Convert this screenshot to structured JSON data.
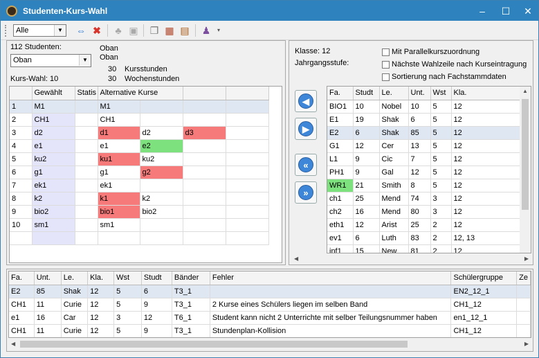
{
  "window": {
    "title": "Studenten-Kurs-Wahl",
    "minimize": "–",
    "maximize": "☐",
    "close": "✕"
  },
  "toolbar": {
    "filter_value": "Alle"
  },
  "left": {
    "student_count": "112 Studenten:",
    "student_value": "Oban",
    "name1": "Oban",
    "name2": "Oban",
    "kursstunden_num": "30",
    "kursstunden_label": "Kursstunden",
    "wochenstunden_num": "30",
    "wochenstunden_label": "Wochenstunden",
    "kurswahl": "Kurs-Wahl: 10",
    "headers": [
      "",
      "Gewählt",
      "Statis",
      "Alternative Kurse",
      "",
      ""
    ],
    "rows": [
      {
        "n": "1",
        "g": "M1",
        "s": "",
        "a": [
          "M1",
          "",
          ""
        ],
        "c": [
          "",
          "",
          ""
        ]
      },
      {
        "n": "2",
        "g": "CH1",
        "s": "",
        "a": [
          "CH1",
          "",
          ""
        ],
        "c": [
          "",
          "",
          ""
        ]
      },
      {
        "n": "3",
        "g": "d2",
        "s": "",
        "a": [
          "d1",
          "d2",
          "d3"
        ],
        "c": [
          "red",
          "",
          "red"
        ]
      },
      {
        "n": "4",
        "g": "e1",
        "s": "",
        "a": [
          "e1",
          "e2",
          ""
        ],
        "c": [
          "",
          "green",
          ""
        ]
      },
      {
        "n": "5",
        "g": "ku2",
        "s": "",
        "a": [
          "ku1",
          "ku2",
          ""
        ],
        "c": [
          "red",
          "",
          ""
        ]
      },
      {
        "n": "6",
        "g": "g1",
        "s": "",
        "a": [
          "g1",
          "g2",
          ""
        ],
        "c": [
          "",
          "red",
          ""
        ]
      },
      {
        "n": "7",
        "g": "ek1",
        "s": "",
        "a": [
          "ek1",
          "",
          ""
        ],
        "c": [
          "",
          "",
          ""
        ]
      },
      {
        "n": "8",
        "g": "k2",
        "s": "",
        "a": [
          "k1",
          "k2",
          ""
        ],
        "c": [
          "red",
          "",
          ""
        ]
      },
      {
        "n": "9",
        "g": "bio2",
        "s": "",
        "a": [
          "bio1",
          "bio2",
          ""
        ],
        "c": [
          "red",
          "",
          ""
        ]
      },
      {
        "n": "10",
        "g": "sm1",
        "s": "",
        "a": [
          "sm1",
          "",
          ""
        ],
        "c": [
          "",
          "",
          ""
        ]
      }
    ]
  },
  "right": {
    "klasse": "Klasse: 12",
    "jahrgang": "Jahrgangsstufe:",
    "chk1": "Mit Parallelkurszuordnung",
    "chk2": "Nächste Wahlzeile nach Kurseintragung",
    "chk3": "Sortierung nach Fachstammdaten",
    "headers": [
      "Fa.",
      "Studt",
      "Le.",
      "Unt.",
      "Wst",
      "Kla."
    ],
    "rows": [
      [
        "BIO1",
        "10",
        "Nobel",
        "10",
        "5",
        "12"
      ],
      [
        "E1",
        "19",
        "Shak",
        "6",
        "5",
        "12"
      ],
      [
        "E2",
        "6",
        "Shak",
        "85",
        "5",
        "12"
      ],
      [
        "G1",
        "12",
        "Cer",
        "13",
        "5",
        "12"
      ],
      [
        "L1",
        "9",
        "Cic",
        "7",
        "5",
        "12"
      ],
      [
        "PH1",
        "9",
        "Gal",
        "12",
        "5",
        "12"
      ],
      [
        "WR1",
        "21",
        "Smith",
        "8",
        "5",
        "12"
      ],
      [
        "ch1",
        "25",
        "Mend",
        "74",
        "3",
        "12"
      ],
      [
        "ch2",
        "16",
        "Mend",
        "80",
        "3",
        "12"
      ],
      [
        "eth1",
        "12",
        "Arist",
        "25",
        "2",
        "12"
      ],
      [
        "ev1",
        "6",
        "Luth",
        "83",
        "2",
        "12, 13"
      ],
      [
        "inf1",
        "15",
        "New",
        "81",
        "2",
        "12"
      ]
    ]
  },
  "bottom": {
    "headers": [
      "Fa.",
      "Unt.",
      "Le.",
      "Kla.",
      "Wst",
      "Studt",
      "Bänder",
      "Fehler",
      "Schülergruppe",
      "Ze"
    ],
    "rows": [
      [
        "E2",
        "85",
        "Shak",
        "12",
        "5",
        "6",
        "T3_1",
        "",
        "EN2_12_1"
      ],
      [
        "CH1",
        "11",
        "Curie",
        "12",
        "5",
        "9",
        "T3_1",
        "2 Kurse eines Schülers liegen im selben Band",
        "CH1_12"
      ],
      [
        "e1",
        "16",
        "Car",
        "12",
        "3",
        "12",
        "T6_1",
        "Student kann nicht 2 Unterrichte mit selber Teilungsnummer haben",
        "en1_12_1"
      ],
      [
        "CH1",
        "11",
        "Curie",
        "12",
        "5",
        "9",
        "T3_1",
        "Stundenplan-Kollision",
        "CH1_12"
      ]
    ]
  }
}
